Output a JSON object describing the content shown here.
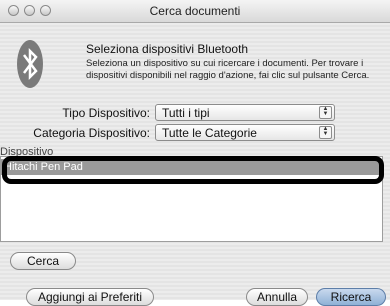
{
  "window": {
    "title": "Cerca documenti"
  },
  "header": {
    "title": "Seleziona dispositivi Bluetooth",
    "description": "Seleziona un dispositivo su cui ricercare i documenti. Per trovare i dispositivi disponibili nel raggio d'azione, fai clic sul pulsante Cerca."
  },
  "filters": {
    "device_type_label": "Tipo Dispositivo:",
    "device_type_value": "Tutti i tipi",
    "device_category_label": "Categoria Dispositivo:",
    "device_category_value": "Tutte le Categorie"
  },
  "devices": {
    "label": "Dispositivo",
    "items": [
      {
        "name": "Hitachi Pen Pad",
        "selected": true
      }
    ]
  },
  "buttons": {
    "search": "Cerca",
    "add_favorites": "Aggiungi ai Preferiti",
    "cancel": "Annulla",
    "search_default": "Ricerca"
  },
  "icons": {
    "bluetooth": "bluetooth-icon",
    "close": "close-icon",
    "minimize": "minimize-icon",
    "zoom": "zoom-icon",
    "select_arrows": "up-down-arrows-icon"
  },
  "colors": {
    "selection_row": "#9a9a9a",
    "default_button": "#8fb1d6"
  }
}
